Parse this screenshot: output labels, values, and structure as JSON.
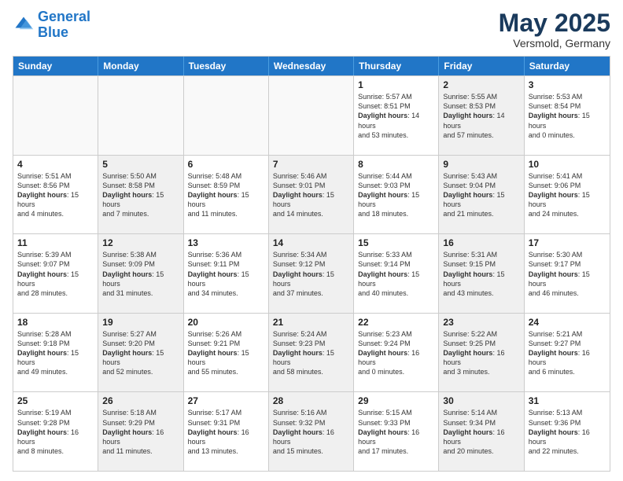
{
  "logo": {
    "line1": "General",
    "line2": "Blue"
  },
  "title": "May 2025",
  "subtitle": "Versmold, Germany",
  "days_of_week": [
    "Sunday",
    "Monday",
    "Tuesday",
    "Wednesday",
    "Thursday",
    "Friday",
    "Saturday"
  ],
  "weeks": [
    [
      {
        "day": "",
        "type": "empty",
        "sunrise": "",
        "sunset": "",
        "daylight": ""
      },
      {
        "day": "",
        "type": "empty",
        "sunrise": "",
        "sunset": "",
        "daylight": ""
      },
      {
        "day": "",
        "type": "empty",
        "sunrise": "",
        "sunset": "",
        "daylight": ""
      },
      {
        "day": "",
        "type": "empty",
        "sunrise": "",
        "sunset": "",
        "daylight": ""
      },
      {
        "day": "1",
        "type": "normal",
        "sunrise": "Sunrise: 5:57 AM",
        "sunset": "Sunset: 8:51 PM",
        "daylight": "Daylight: 14 hours and 53 minutes."
      },
      {
        "day": "2",
        "type": "shaded",
        "sunrise": "Sunrise: 5:55 AM",
        "sunset": "Sunset: 8:53 PM",
        "daylight": "Daylight: 14 hours and 57 minutes."
      },
      {
        "day": "3",
        "type": "normal",
        "sunrise": "Sunrise: 5:53 AM",
        "sunset": "Sunset: 8:54 PM",
        "daylight": "Daylight: 15 hours and 0 minutes."
      }
    ],
    [
      {
        "day": "4",
        "type": "normal",
        "sunrise": "Sunrise: 5:51 AM",
        "sunset": "Sunset: 8:56 PM",
        "daylight": "Daylight: 15 hours and 4 minutes."
      },
      {
        "day": "5",
        "type": "shaded",
        "sunrise": "Sunrise: 5:50 AM",
        "sunset": "Sunset: 8:58 PM",
        "daylight": "Daylight: 15 hours and 7 minutes."
      },
      {
        "day": "6",
        "type": "normal",
        "sunrise": "Sunrise: 5:48 AM",
        "sunset": "Sunset: 8:59 PM",
        "daylight": "Daylight: 15 hours and 11 minutes."
      },
      {
        "day": "7",
        "type": "shaded",
        "sunrise": "Sunrise: 5:46 AM",
        "sunset": "Sunset: 9:01 PM",
        "daylight": "Daylight: 15 hours and 14 minutes."
      },
      {
        "day": "8",
        "type": "normal",
        "sunrise": "Sunrise: 5:44 AM",
        "sunset": "Sunset: 9:03 PM",
        "daylight": "Daylight: 15 hours and 18 minutes."
      },
      {
        "day": "9",
        "type": "shaded",
        "sunrise": "Sunrise: 5:43 AM",
        "sunset": "Sunset: 9:04 PM",
        "daylight": "Daylight: 15 hours and 21 minutes."
      },
      {
        "day": "10",
        "type": "normal",
        "sunrise": "Sunrise: 5:41 AM",
        "sunset": "Sunset: 9:06 PM",
        "daylight": "Daylight: 15 hours and 24 minutes."
      }
    ],
    [
      {
        "day": "11",
        "type": "normal",
        "sunrise": "Sunrise: 5:39 AM",
        "sunset": "Sunset: 9:07 PM",
        "daylight": "Daylight: 15 hours and 28 minutes."
      },
      {
        "day": "12",
        "type": "shaded",
        "sunrise": "Sunrise: 5:38 AM",
        "sunset": "Sunset: 9:09 PM",
        "daylight": "Daylight: 15 hours and 31 minutes."
      },
      {
        "day": "13",
        "type": "normal",
        "sunrise": "Sunrise: 5:36 AM",
        "sunset": "Sunset: 9:11 PM",
        "daylight": "Daylight: 15 hours and 34 minutes."
      },
      {
        "day": "14",
        "type": "shaded",
        "sunrise": "Sunrise: 5:34 AM",
        "sunset": "Sunset: 9:12 PM",
        "daylight": "Daylight: 15 hours and 37 minutes."
      },
      {
        "day": "15",
        "type": "normal",
        "sunrise": "Sunrise: 5:33 AM",
        "sunset": "Sunset: 9:14 PM",
        "daylight": "Daylight: 15 hours and 40 minutes."
      },
      {
        "day": "16",
        "type": "shaded",
        "sunrise": "Sunrise: 5:31 AM",
        "sunset": "Sunset: 9:15 PM",
        "daylight": "Daylight: 15 hours and 43 minutes."
      },
      {
        "day": "17",
        "type": "normal",
        "sunrise": "Sunrise: 5:30 AM",
        "sunset": "Sunset: 9:17 PM",
        "daylight": "Daylight: 15 hours and 46 minutes."
      }
    ],
    [
      {
        "day": "18",
        "type": "normal",
        "sunrise": "Sunrise: 5:28 AM",
        "sunset": "Sunset: 9:18 PM",
        "daylight": "Daylight: 15 hours and 49 minutes."
      },
      {
        "day": "19",
        "type": "shaded",
        "sunrise": "Sunrise: 5:27 AM",
        "sunset": "Sunset: 9:20 PM",
        "daylight": "Daylight: 15 hours and 52 minutes."
      },
      {
        "day": "20",
        "type": "normal",
        "sunrise": "Sunrise: 5:26 AM",
        "sunset": "Sunset: 9:21 PM",
        "daylight": "Daylight: 15 hours and 55 minutes."
      },
      {
        "day": "21",
        "type": "shaded",
        "sunrise": "Sunrise: 5:24 AM",
        "sunset": "Sunset: 9:23 PM",
        "daylight": "Daylight: 15 hours and 58 minutes."
      },
      {
        "day": "22",
        "type": "normal",
        "sunrise": "Sunrise: 5:23 AM",
        "sunset": "Sunset: 9:24 PM",
        "daylight": "Daylight: 16 hours and 0 minutes."
      },
      {
        "day": "23",
        "type": "shaded",
        "sunrise": "Sunrise: 5:22 AM",
        "sunset": "Sunset: 9:25 PM",
        "daylight": "Daylight: 16 hours and 3 minutes."
      },
      {
        "day": "24",
        "type": "normal",
        "sunrise": "Sunrise: 5:21 AM",
        "sunset": "Sunset: 9:27 PM",
        "daylight": "Daylight: 16 hours and 6 minutes."
      }
    ],
    [
      {
        "day": "25",
        "type": "normal",
        "sunrise": "Sunrise: 5:19 AM",
        "sunset": "Sunset: 9:28 PM",
        "daylight": "Daylight: 16 hours and 8 minutes."
      },
      {
        "day": "26",
        "type": "shaded",
        "sunrise": "Sunrise: 5:18 AM",
        "sunset": "Sunset: 9:29 PM",
        "daylight": "Daylight: 16 hours and 11 minutes."
      },
      {
        "day": "27",
        "type": "normal",
        "sunrise": "Sunrise: 5:17 AM",
        "sunset": "Sunset: 9:31 PM",
        "daylight": "Daylight: 16 hours and 13 minutes."
      },
      {
        "day": "28",
        "type": "shaded",
        "sunrise": "Sunrise: 5:16 AM",
        "sunset": "Sunset: 9:32 PM",
        "daylight": "Daylight: 16 hours and 15 minutes."
      },
      {
        "day": "29",
        "type": "normal",
        "sunrise": "Sunrise: 5:15 AM",
        "sunset": "Sunset: 9:33 PM",
        "daylight": "Daylight: 16 hours and 17 minutes."
      },
      {
        "day": "30",
        "type": "shaded",
        "sunrise": "Sunrise: 5:14 AM",
        "sunset": "Sunset: 9:34 PM",
        "daylight": "Daylight: 16 hours and 20 minutes."
      },
      {
        "day": "31",
        "type": "normal",
        "sunrise": "Sunrise: 5:13 AM",
        "sunset": "Sunset: 9:36 PM",
        "daylight": "Daylight: 16 hours and 22 minutes."
      }
    ]
  ]
}
